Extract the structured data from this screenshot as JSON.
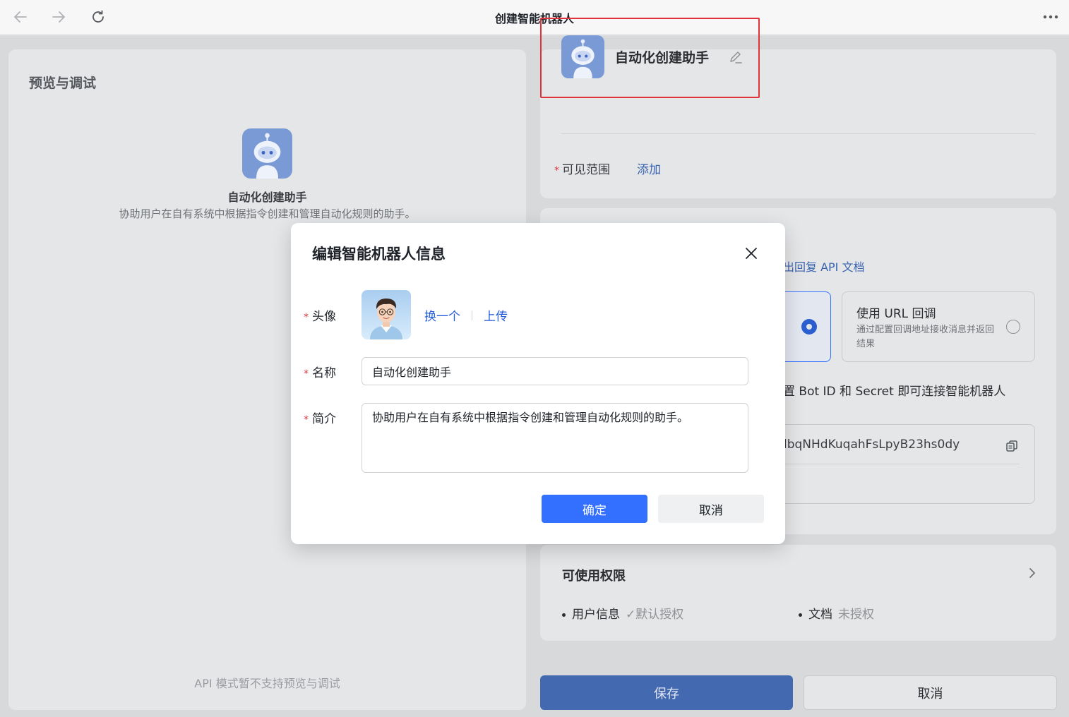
{
  "window": {
    "title": "创建智能机器人"
  },
  "left_panel": {
    "title": "预览与调试",
    "bot_name": "自动化创建助手",
    "bot_description": "协助用户在自有系统中根据指令创建和管理自动化规则的助手。",
    "footer_note": "API 模式暂不支持预览与调试"
  },
  "bot_header": {
    "name": "自动化创建助手"
  },
  "visibility": {
    "required_mark": "*",
    "label": "可见范围",
    "add_link": "添加"
  },
  "mode_section": {
    "api_doc_text": "出回复 API 文档",
    "option_url_callback": {
      "title": "使用 URL 回调",
      "description": "通过配置回调地址接收消息并返回结果"
    },
    "bot_id_hint": "置 Bot ID 和 Secret 即可连接智能机器人",
    "secret_value": "lbqNHdKuqahFsLpyB23hs0dy"
  },
  "permissions": {
    "title": "可使用权限",
    "items": [
      {
        "name": "用户信息",
        "status": "默认授权",
        "check": "✓"
      },
      {
        "name": "文档",
        "status": "未授权"
      }
    ]
  },
  "actions": {
    "save": "保存",
    "cancel": "取消"
  },
  "modal": {
    "title": "编辑智能机器人信息",
    "required_mark": "*",
    "avatar_label": "头像",
    "change_link": "换一个",
    "upload_link": "上传",
    "name_label": "名称",
    "name_value": "自动化创建助手",
    "desc_label": "简介",
    "desc_value": "协助用户在自有系统中根据指令创建和管理自动化规则的助手。",
    "confirm": "确定",
    "cancel": "取消"
  },
  "colors": {
    "accent": "#3370ff",
    "link": "#245bdb",
    "required": "#d9363e",
    "highlight_border": "#e0343a"
  }
}
